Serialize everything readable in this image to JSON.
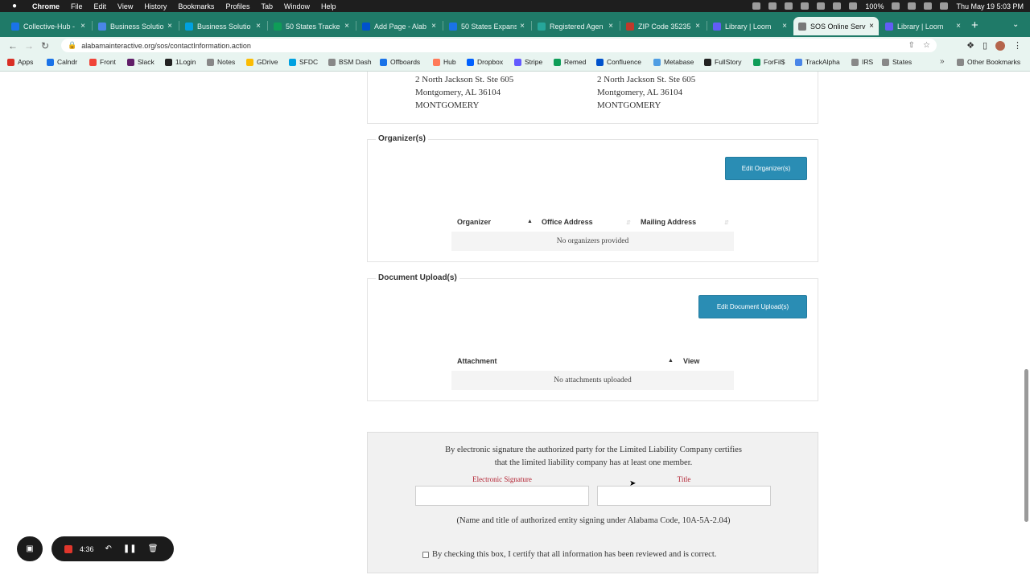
{
  "menubar": {
    "app": "Chrome",
    "items": [
      "File",
      "Edit",
      "View",
      "History",
      "Bookmarks",
      "Profiles",
      "Tab",
      "Window",
      "Help"
    ],
    "battery": "100%",
    "clock": "Thu May 19  5:03 PM"
  },
  "tabs": [
    {
      "label": "Collective-Hub -",
      "color": "#1a73e8",
      "active": false
    },
    {
      "label": "Business Solutio",
      "color": "#4a86e8",
      "active": false
    },
    {
      "label": "Business Solutio",
      "color": "#00a1e0",
      "active": false
    },
    {
      "label": "50 States Tracke",
      "color": "#0f9d58",
      "active": false
    },
    {
      "label": "Add Page - Alab",
      "color": "#0052cc",
      "active": false
    },
    {
      "label": "50 States Expans",
      "color": "#1a73e8",
      "active": false
    },
    {
      "label": "Registered Agen",
      "color": "#26a69a",
      "active": false
    },
    {
      "label": "ZIP Code 35235",
      "color": "#c0392b",
      "active": false
    },
    {
      "label": "Library | Loom",
      "color": "#625df5",
      "active": false
    },
    {
      "label": "SOS Online Serv",
      "color": "#777777",
      "active": true
    },
    {
      "label": "Library | Loom",
      "color": "#625df5",
      "active": false
    }
  ],
  "address_bar": {
    "url": "alabamainteractive.org/sos/contactInformation.action"
  },
  "bookmarks": [
    {
      "label": "Apps",
      "color": "#d93025"
    },
    {
      "label": "Calndr",
      "color": "#1a73e8"
    },
    {
      "label": "Front",
      "color": "#f04438"
    },
    {
      "label": "Slack",
      "color": "#611f69"
    },
    {
      "label": "1Login",
      "color": "#222222"
    },
    {
      "label": "Notes",
      "color": "#888888"
    },
    {
      "label": "GDrive",
      "color": "#fbbc04"
    },
    {
      "label": "SFDC",
      "color": "#00a1e0"
    },
    {
      "label": "BSM Dash",
      "color": "#888888"
    },
    {
      "label": "Offboards",
      "color": "#1a73e8"
    },
    {
      "label": "Hub",
      "color": "#ff7a59"
    },
    {
      "label": "Dropbox",
      "color": "#0061ff"
    },
    {
      "label": "Stripe",
      "color": "#635bff"
    },
    {
      "label": "Remed",
      "color": "#0f9d58"
    },
    {
      "label": "Confluence",
      "color": "#0052cc"
    },
    {
      "label": "Metabase",
      "color": "#509ee3"
    },
    {
      "label": "FullStory",
      "color": "#222222"
    },
    {
      "label": "ForFil$",
      "color": "#0f9d58"
    },
    {
      "label": "TrackAlpha",
      "color": "#4a86e8"
    },
    {
      "label": "IRS",
      "color": "#888888"
    },
    {
      "label": "States",
      "color": "#888888"
    }
  ],
  "other_bookmarks": "Other Bookmarks",
  "addresses": {
    "left": [
      "2 North Jackson St. Ste 605",
      "Montgomery, AL 36104",
      "MONTGOMERY"
    ],
    "right": [
      "2 North Jackson St. Ste 605",
      "Montgomery, AL 36104",
      "MONTGOMERY"
    ]
  },
  "organizers": {
    "legend": "Organizer(s)",
    "edit_button": "Edit Organizer(s)",
    "columns": [
      "Organizer",
      "Office Address",
      "Mailing Address"
    ],
    "empty_text": "No organizers provided"
  },
  "documents": {
    "legend": "Document Upload(s)",
    "edit_button": "Edit Document Upload(s)",
    "columns": [
      "Attachment",
      "View"
    ],
    "empty_text": "No attachments uploaded"
  },
  "signature": {
    "statement_line1": "By electronic signature the authorized party for the Limited Liability Company certifies",
    "statement_line2": "that the limited liability company has at least one member.",
    "sig_label": "Electronic Signature",
    "sig_value": "",
    "title_label": "Title",
    "title_value": "",
    "note": "(Name and title of authorized entity signing under Alabama Code, 10A-5A-2.04)",
    "certify": "By checking this box, I certify that all information has been reviewed and is correct."
  },
  "recorder": {
    "time": "4:36"
  }
}
